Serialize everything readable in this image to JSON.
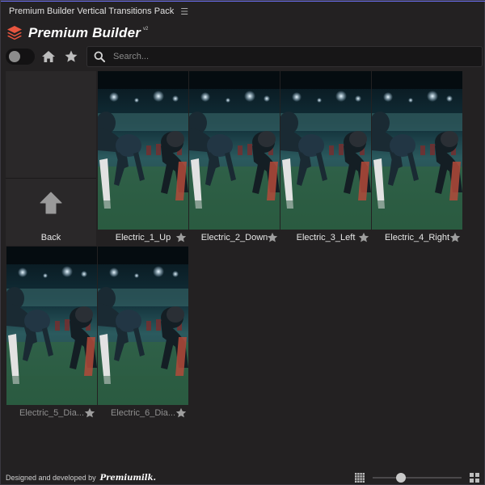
{
  "panel": {
    "title": "Premium Builder Vertical Transitions Pack",
    "menu_icon": "hamburger-icon"
  },
  "brand": {
    "name": "Premium Builder",
    "version": "v2",
    "logo_icon": "layers-icon",
    "logo_color": "#e8553f"
  },
  "toolbar": {
    "toggle_on": false,
    "home_icon": "home-icon",
    "favorites_icon": "star-icon",
    "search_icon": "search-icon",
    "search_placeholder": "Search...",
    "search_value": ""
  },
  "back": {
    "label": "Back",
    "icon": "arrow-up-icon"
  },
  "items": [
    {
      "name": "Electric_1_Up",
      "favorite": false,
      "dim": false
    },
    {
      "name": "Electric_2_Down",
      "favorite": false,
      "dim": false
    },
    {
      "name": "Electric_3_Left",
      "favorite": false,
      "dim": false
    },
    {
      "name": "Electric_4_Right",
      "favorite": false,
      "dim": false
    },
    {
      "name": "Electric_5_Dia...",
      "favorite": false,
      "dim": true
    },
    {
      "name": "Electric_6_Dia...",
      "favorite": false,
      "dim": true
    }
  ],
  "footer": {
    "credit": "Designed and developed by",
    "credit_brand": "Premiumilk.",
    "grid_small_icon": "grid-small-icon",
    "grid_large_icon": "grid-large-icon",
    "thumb_size": 0.3
  }
}
